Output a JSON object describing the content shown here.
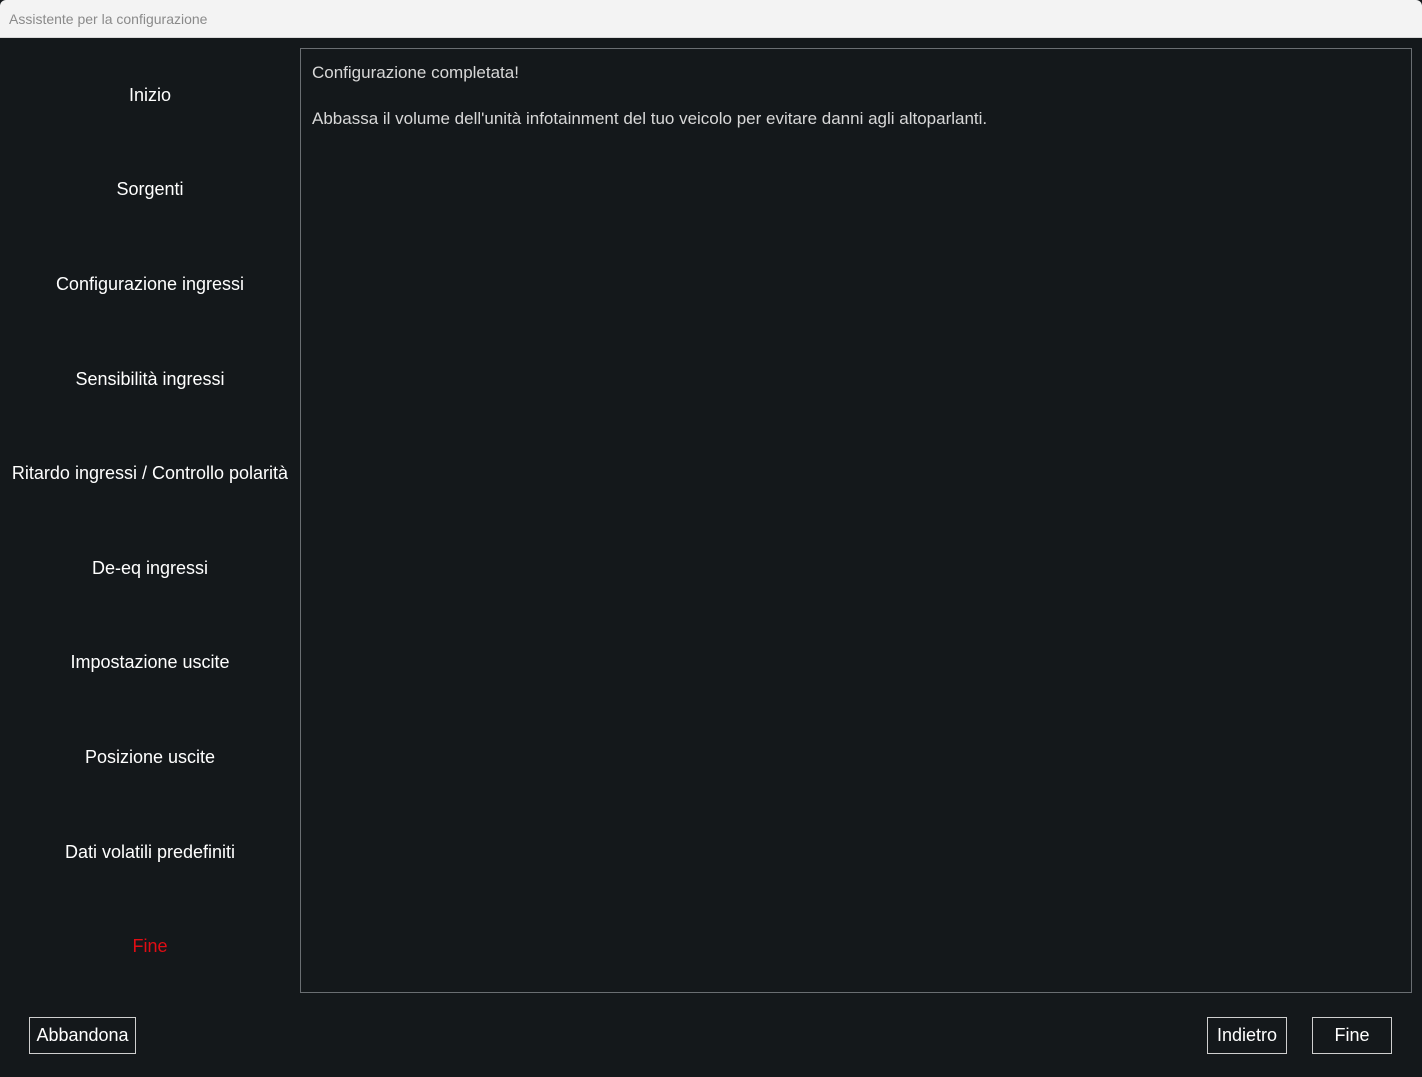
{
  "window": {
    "title": "Assistente per la configurazione"
  },
  "sidebar": {
    "items": [
      {
        "label": "Inizio",
        "active": false
      },
      {
        "label": "Sorgenti",
        "active": false
      },
      {
        "label": "Configurazione ingressi",
        "active": false
      },
      {
        "label": "Sensibilità ingressi",
        "active": false
      },
      {
        "label": "Ritardo ingressi / Controllo polarità",
        "active": false
      },
      {
        "label": "De-eq ingressi",
        "active": false
      },
      {
        "label": "Impostazione uscite",
        "active": false
      },
      {
        "label": "Posizione uscite",
        "active": false
      },
      {
        "label": "Dati volatili predefiniti",
        "active": false
      },
      {
        "label": "Fine",
        "active": true
      }
    ],
    "active_color": "#e00d14"
  },
  "content": {
    "heading": "Configurazione completata!",
    "message": "Abbassa il volume dell'unità infotainment del tuo veicolo per evitare danni agli altoparlanti."
  },
  "footer": {
    "abandon_label": "Abbandona",
    "back_label": "Indietro",
    "finish_label": "Fine"
  }
}
